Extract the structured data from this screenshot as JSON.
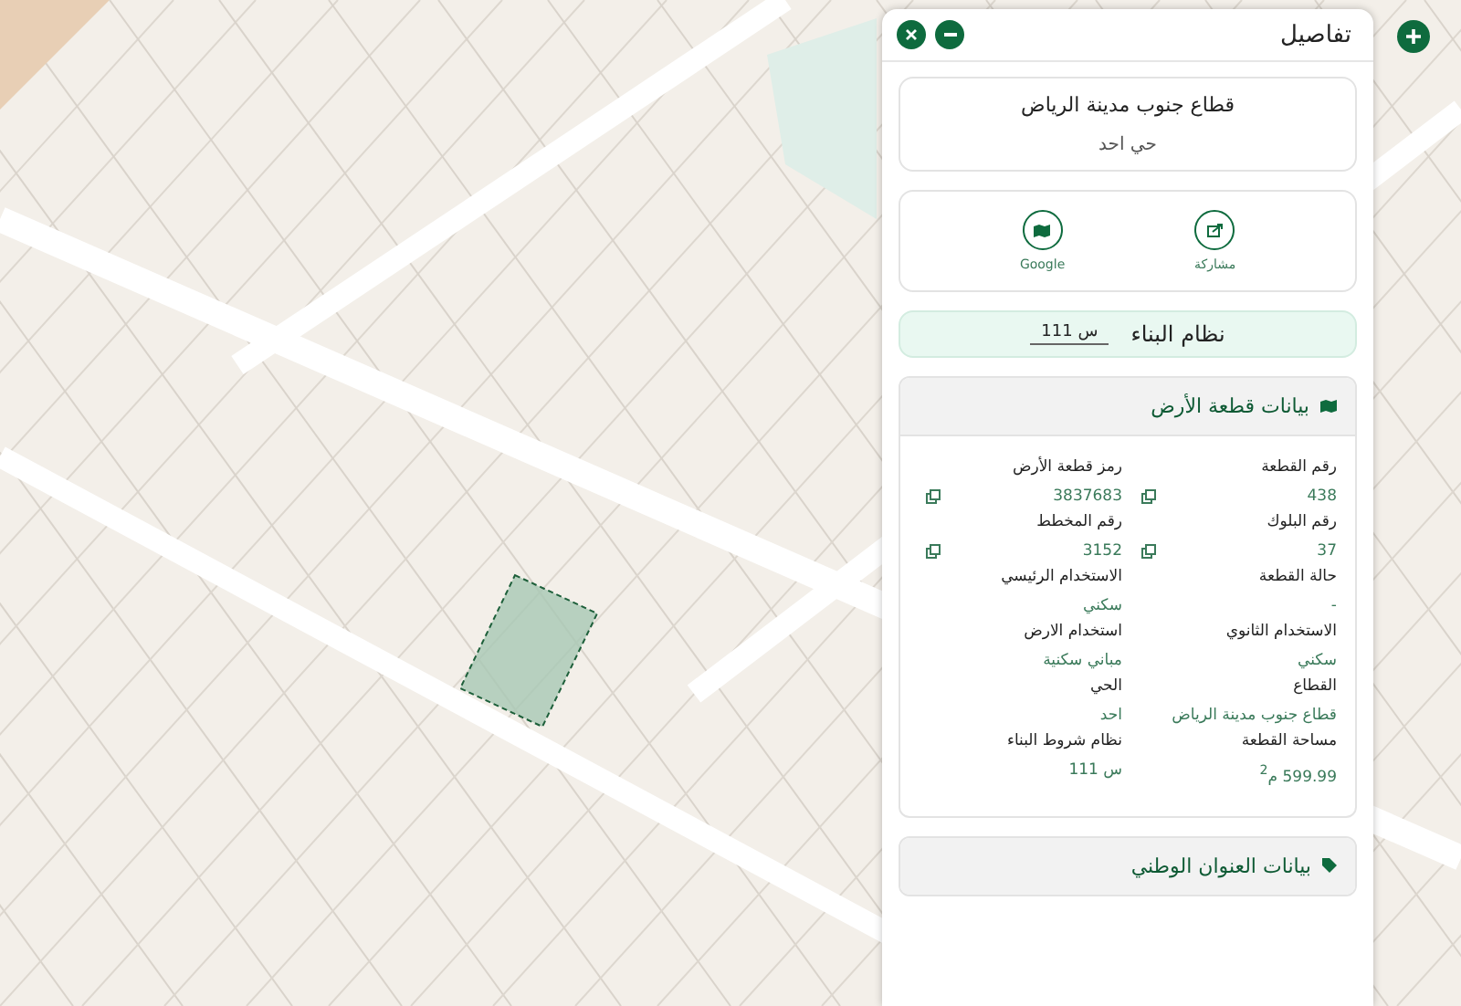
{
  "panel": {
    "title": "تفاصيل"
  },
  "location": {
    "sector": "قطاع جنوب مدينة الرياض",
    "district": "حي احد"
  },
  "actions": [
    {
      "kind": "share",
      "label": "مشاركة"
    },
    {
      "kind": "google",
      "label": "Google"
    }
  ],
  "building_system": {
    "label": "نظام البناء",
    "value": "س 111"
  },
  "land_section": {
    "title": "بيانات قطعة الأرض",
    "expanded": true,
    "fields": [
      {
        "label": "رقم القطعة",
        "value": "438",
        "copyable": true
      },
      {
        "label": "رمز قطعة الأرض",
        "value": "3837683",
        "copyable": true
      },
      {
        "label": "رقم البلوك",
        "value": "37",
        "copyable": true
      },
      {
        "label": "رقم المخطط",
        "value": "3152",
        "copyable": true
      },
      {
        "label": "حالة القطعة",
        "value": "-",
        "copyable": false
      },
      {
        "label": "الاستخدام الرئيسي",
        "value": "سكني",
        "copyable": false
      },
      {
        "label": "الاستخدام الثانوي",
        "value": "سكني",
        "copyable": false
      },
      {
        "label": "استخدام الارض",
        "value": "مباني سكنية",
        "copyable": false
      },
      {
        "label": "القطاع",
        "value": "قطاع جنوب مدينة الرياض",
        "copyable": false
      },
      {
        "label": "الحي",
        "value": "احد",
        "copyable": false
      },
      {
        "label": "مساحة القطعة",
        "value": "599.99 م$^{2}$",
        "copyable": false
      },
      {
        "label": "نظام شروط البناء",
        "value": "س 111",
        "copyable": false
      }
    ]
  },
  "address_section": {
    "title": "بيانات العنوان الوطني",
    "expanded": false
  }
}
